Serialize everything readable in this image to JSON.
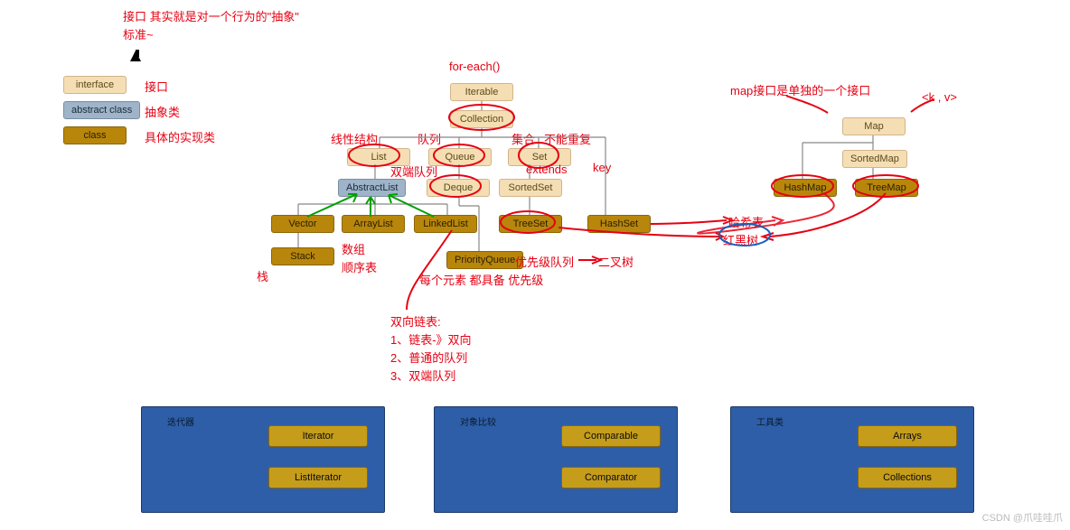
{
  "topAnnotations": {
    "line1": "接口 其实就是对一个行为的\"抽象\"",
    "line2": "标准~"
  },
  "legend": {
    "interface": {
      "label": "interface",
      "annot": "接口"
    },
    "abstract": {
      "label": "abstract class",
      "annot": "抽象类"
    },
    "class": {
      "label": "class",
      "annot": "具体的实现类"
    }
  },
  "nodes": {
    "Iterable": "Iterable",
    "Collection": "Collection",
    "List": "List",
    "Queue": "Queue",
    "Set": "Set",
    "AbstractList": "AbstractList",
    "Deque": "Deque",
    "SortedSet": "SortedSet",
    "Vector": "Vector",
    "ArrayList": "ArrayList",
    "LinkedList": "LinkedList",
    "TreeSet": "TreeSet",
    "HashSet": "HashSet",
    "Stack": "Stack",
    "PriorityQueue": "PriorityQueue",
    "Map": "Map",
    "SortedMap": "SortedMap",
    "HashMap": "HashMap",
    "TreeMap": "TreeMap"
  },
  "annotations": {
    "forEach": "for-each()",
    "linear": "线性结构",
    "queueCol": "队列",
    "setLabel": "集合",
    "noRepeat": "不能重复",
    "dequeLabel": "双端队列",
    "extends": "extends",
    "key": "key",
    "arrayImpl1": "数组",
    "arrayImpl2": "顺序表",
    "stackLabel": "栈",
    "pqLabel": "优先级队列",
    "binaryTree": "二叉树",
    "pqNote": "每个元素 都具备     优先级",
    "doublyList": "双向链表:",
    "dl1": "1、链表-》双向",
    "dl2": "2、普通的队列",
    "dl3": "3、双端队列",
    "mapNote": "map接口是单独的一个接口",
    "kv": "<k , v>",
    "hashTable": "哈希表",
    "rbTree": "红黑树"
  },
  "panels": {
    "iterator": {
      "title": "迭代器",
      "a": "Iterator",
      "b": "ListIterator"
    },
    "compare": {
      "title": "对象比较",
      "a": "Comparable",
      "b": "Comparator"
    },
    "utils": {
      "title": "工具类",
      "a": "Arrays",
      "b": "Collections"
    }
  },
  "watermark": "CSDN @爪哇哇爪"
}
